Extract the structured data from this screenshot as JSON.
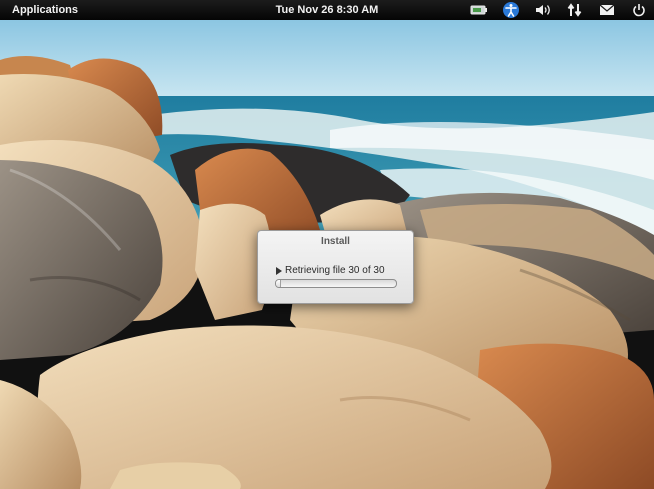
{
  "panel": {
    "applications_label": "Applications",
    "clock": "Tue Nov 26  8:30 AM",
    "tray_icons": [
      "battery-icon",
      "accessibility-icon",
      "volume-icon",
      "network-icon",
      "mail-icon",
      "power-icon"
    ]
  },
  "dialog": {
    "title": "Install",
    "status_text": "Retrieving file 30 of 30",
    "progress_fraction": 0.03
  },
  "colors": {
    "panel_background": "#0d0d0d",
    "accessibility_blue": "#2a79d8",
    "sky": "#9ed0e8",
    "sea": "#2b8fae"
  }
}
